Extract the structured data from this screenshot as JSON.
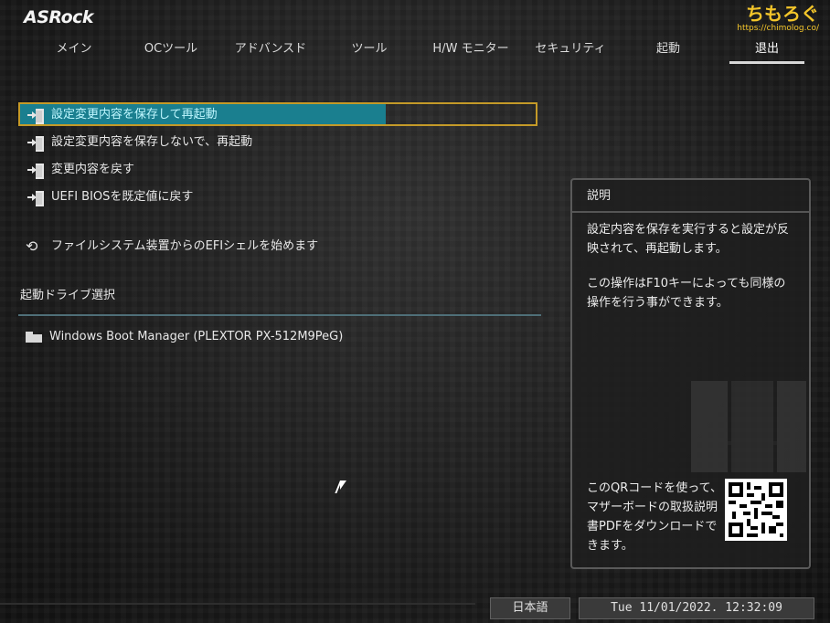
{
  "app": {
    "logo": "ASRock",
    "watermark_title": "ちもろぐ",
    "watermark_url": "https://chimolog.co/"
  },
  "tabs": [
    {
      "label": "メイン"
    },
    {
      "label": "OCツール"
    },
    {
      "label": "アドバンスド"
    },
    {
      "label": "ツール"
    },
    {
      "label": "H/W モニター"
    },
    {
      "label": "セキュリティ"
    },
    {
      "label": "起動"
    },
    {
      "label": "退出"
    }
  ],
  "active_tab": "退出",
  "menu": {
    "items": [
      {
        "label": "設定変更内容を保存して再起動",
        "icon": "exit-icon"
      },
      {
        "label": "設定変更内容を保存しないで、再起動",
        "icon": "exit-icon"
      },
      {
        "label": "変更内容を戻す",
        "icon": "exit-icon"
      },
      {
        "label": "UEFI BIOSを既定値に戻す",
        "icon": "exit-icon"
      },
      {
        "label": "ファイルシステム装置からのEFIシェルを始めます",
        "icon": "loop-arrow-icon"
      }
    ],
    "selected": "設定変更内容を保存して再起動"
  },
  "boot_section": {
    "label": "起動ドライブ選択",
    "drives": [
      {
        "label": "Windows Boot Manager (PLEXTOR PX-512M9PeG)",
        "icon": "folder-icon"
      }
    ]
  },
  "description": {
    "title": "説明",
    "para1": "設定内容を保存を実行すると設定が反映されて、再起動します。",
    "para2": "この操作はF10キーによっても同様の操作を行う事ができます。",
    "qr_text": "このQRコードを使って、マザーボードの取扱説明書PDFをダウンロードできます。"
  },
  "footer": {
    "language": "日本語",
    "datetime": "Tue 11/01/2022. 12:32:09"
  },
  "colors": {
    "selection_fill": "#1a7f8f",
    "selection_border": "#c49a28",
    "watermark": "#f3c52a"
  }
}
